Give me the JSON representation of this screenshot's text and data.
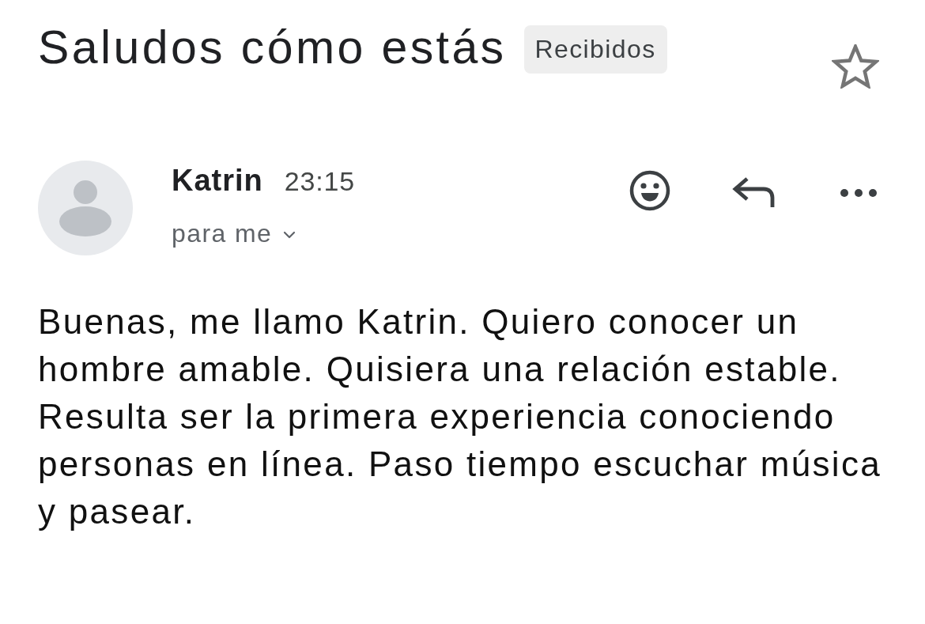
{
  "subject": {
    "title": "Saludos cómo estás",
    "label": "Recibidos",
    "starred": false
  },
  "message": {
    "sender": "Katrin",
    "time": "23:15",
    "recipient": "para me",
    "recipient_details_expanded": false,
    "body": "Buenas, me llamo Katrin. Quiero conocer un hombre amable. Quisiera una relación estable. Resulta ser la primera experiencia conociendo personas en línea. Paso tiempo escuchar música y pasear."
  }
}
